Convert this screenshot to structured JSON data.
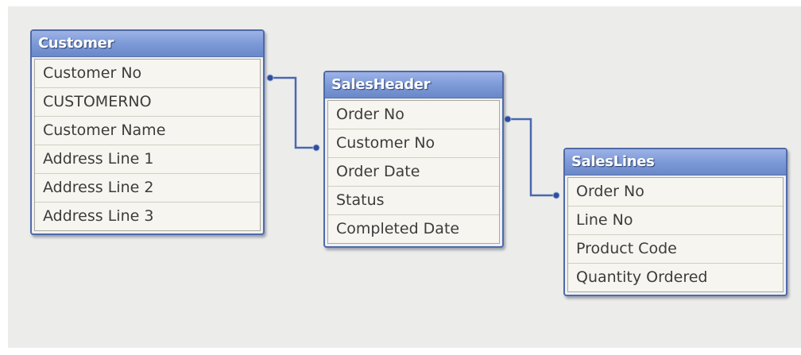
{
  "tables": [
    {
      "name": "Customer",
      "fields": [
        "Customer No",
        "CUSTOMERNO",
        "Customer Name",
        "Address Line 1",
        "Address Line 2",
        "Address Line 3"
      ]
    },
    {
      "name": "SalesHeader",
      "fields": [
        "Order No",
        "Customer No",
        "Order Date",
        "Status",
        "Completed Date"
      ]
    },
    {
      "name": "SalesLines",
      "fields": [
        "Order No",
        "Line No",
        "Product Code",
        "Quantity Ordered"
      ]
    }
  ],
  "colors": {
    "header": "#7f9cd9",
    "border": "#4f6aa8",
    "link": "#4a68b0",
    "background": "#ececea"
  }
}
